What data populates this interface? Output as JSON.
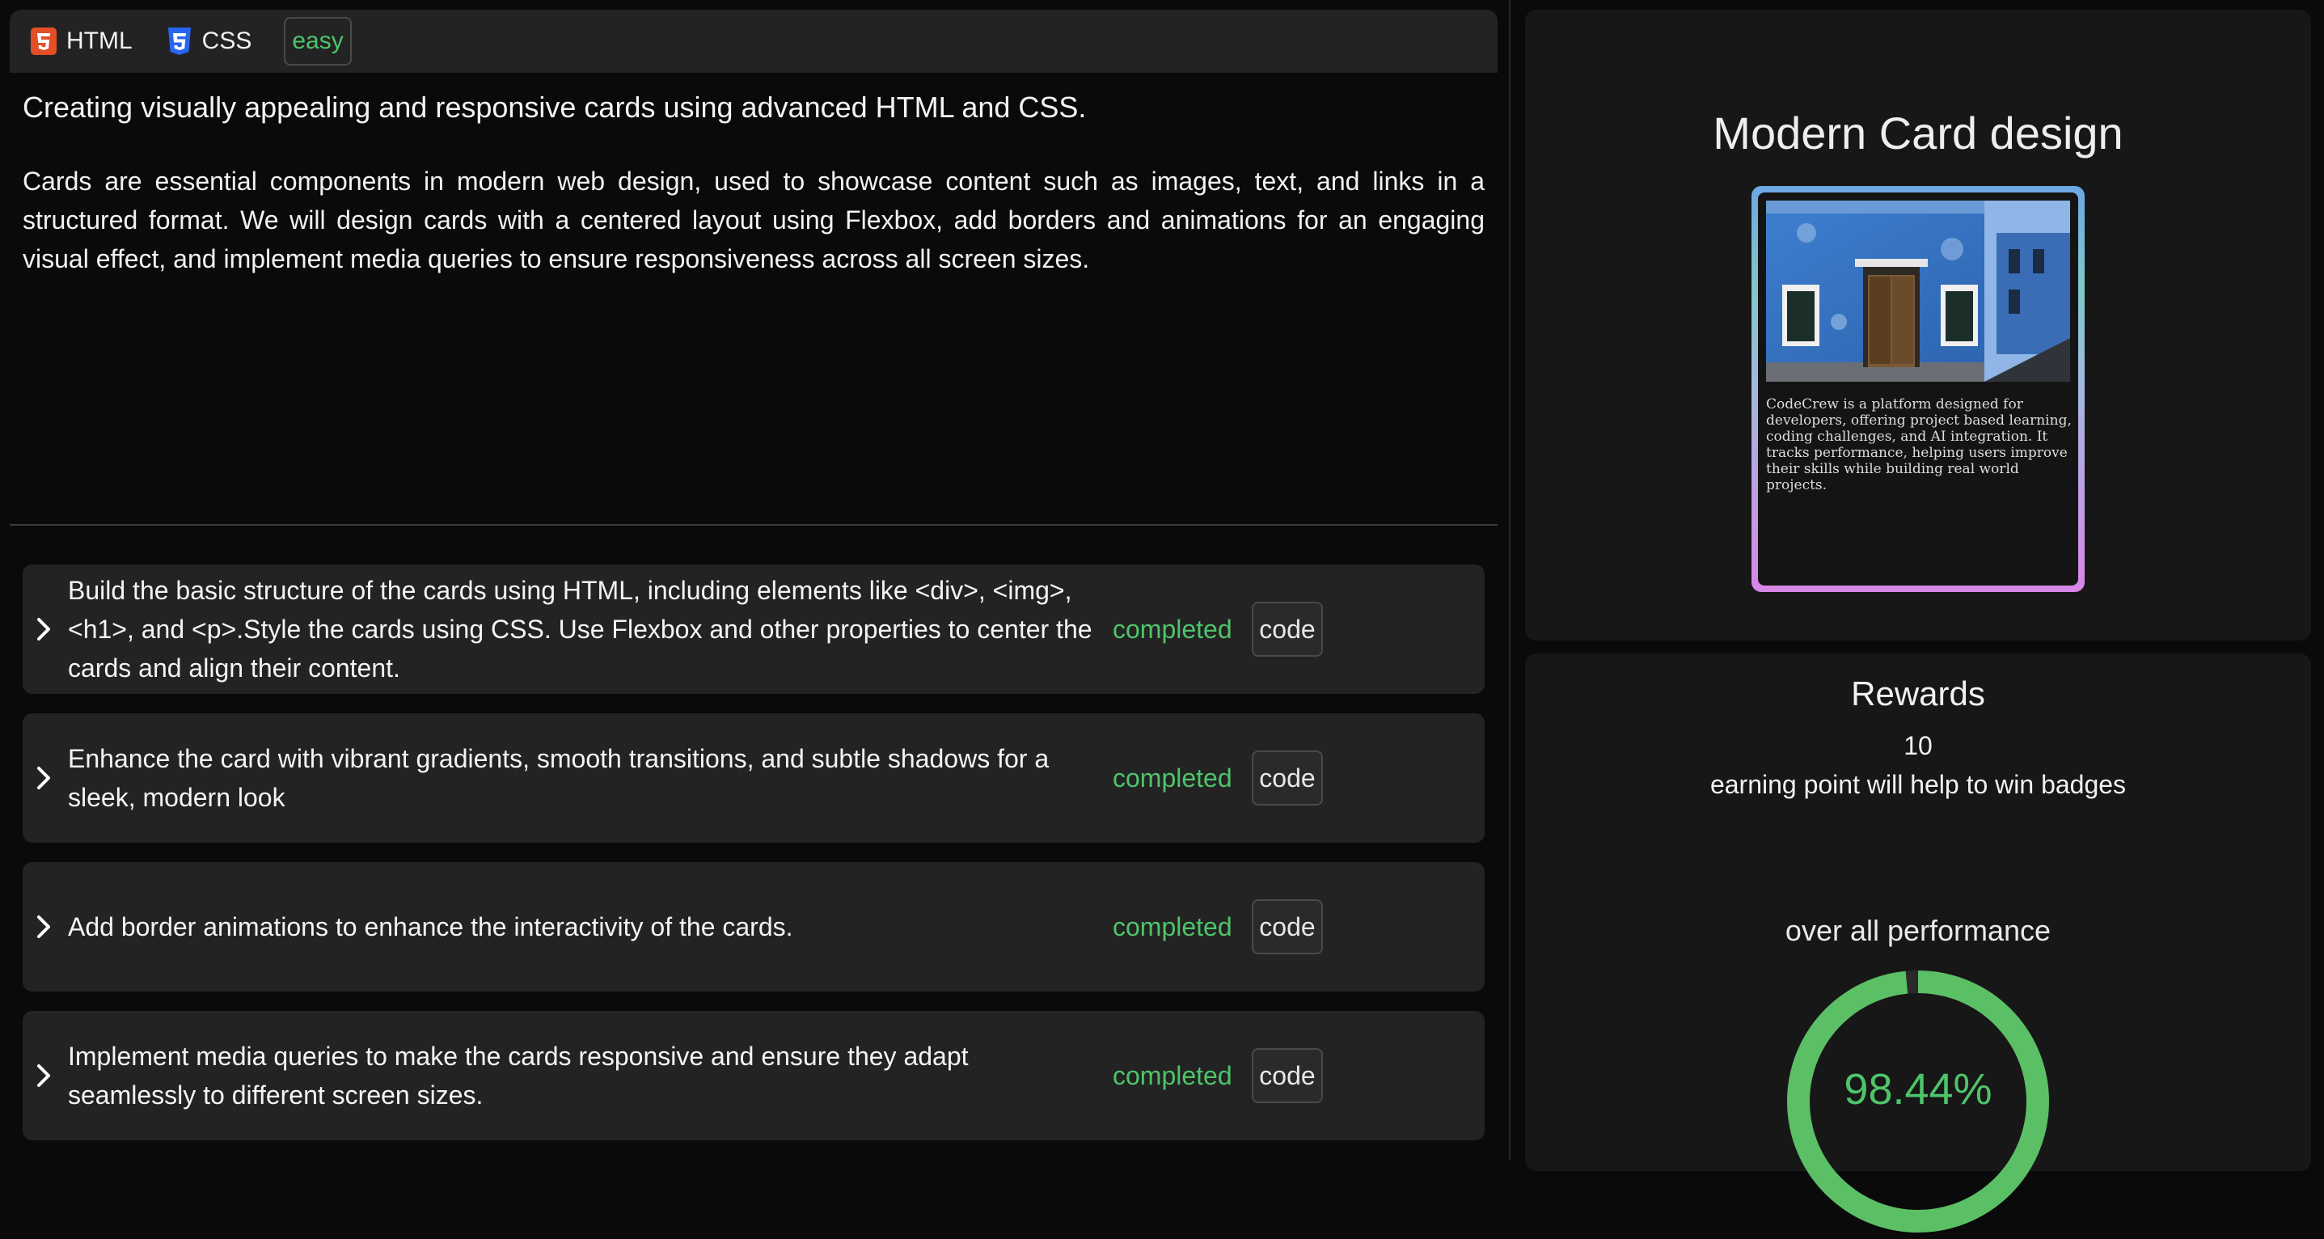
{
  "tags": {
    "html": "HTML",
    "css": "CSS",
    "difficulty": "easy"
  },
  "heading": "Creating visually appealing and responsive cards using advanced HTML and CSS.",
  "description": "Cards are essential components in modern web design, used to showcase content such as images, text, and links in a structured format. We will design cards with a centered layout using Flexbox, add borders and animations for an engaging visual effect, and implement media queries to ensure responsiveness across all screen sizes.",
  "tasks": [
    {
      "text": "Build the basic structure of the cards using HTML, including elements like <div>, <img>, <h1>, and <p>.Style the cards using CSS. Use Flexbox and other properties to center the cards and align their content.",
      "status": "completed",
      "code_label": "code"
    },
    {
      "text": "Enhance the card with vibrant gradients, smooth transitions, and subtle shadows for a sleek, modern look",
      "status": "completed",
      "code_label": "code"
    },
    {
      "text": "Add border animations to enhance the interactivity of the cards.",
      "status": "completed",
      "code_label": "code"
    },
    {
      "text": "Implement media queries to make the cards responsive and ensure they adapt seamlessly to different screen sizes.",
      "status": "completed",
      "code_label": "code"
    }
  ],
  "preview": {
    "title": "Modern Card design",
    "card_text": "CodeCrew is a platform designed for developers, offering project based learning, coding challenges, and AI integration. It tracks performance, helping users improve their skills while building real world projects."
  },
  "rewards": {
    "title": "Rewards",
    "points": "10",
    "points_desc": "earning point will help to win badges",
    "performance_label": "over all performance",
    "performance_value": "98.44%",
    "performance_fraction": 0.9844
  },
  "colors": {
    "accent_green": "#4ec46a",
    "panel": "#232323",
    "background": "#0a0a0a"
  },
  "icons": [
    "html5-icon",
    "css3-icon",
    "chevron-right-icon"
  ]
}
